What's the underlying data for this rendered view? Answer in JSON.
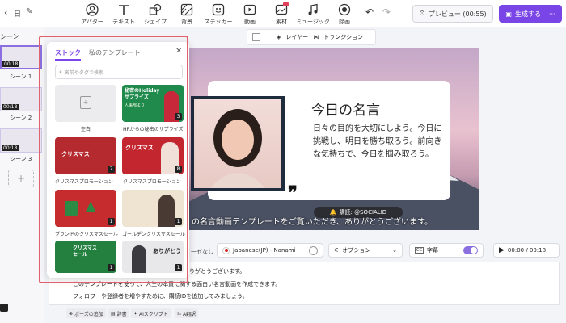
{
  "topbar": {
    "tools": [
      {
        "label": "アバター",
        "icon": "avatar-icon"
      },
      {
        "label": "テキスト",
        "icon": "text-icon"
      },
      {
        "label": "シェイプ",
        "icon": "shape-icon"
      },
      {
        "label": "背景",
        "icon": "background-icon"
      },
      {
        "label": "ステッカー",
        "icon": "sticker-icon"
      },
      {
        "label": "動画",
        "icon": "video-icon"
      },
      {
        "label": "素材",
        "icon": "material-icon"
      },
      {
        "label": "ミュージック",
        "icon": "music-icon"
      },
      {
        "label": "録画",
        "icon": "record-icon"
      }
    ],
    "left_label": "日",
    "preview": "プレビュー (00:55)",
    "generate": "生成する",
    "more": "···"
  },
  "scenes": {
    "header": "シーン",
    "items": [
      {
        "label": "シーン 1",
        "time": "00:18"
      },
      {
        "label": "シーン 2",
        "time": "00:18"
      },
      {
        "label": "シーン 3",
        "time": "00:18"
      }
    ]
  },
  "canvas_bar": {
    "layer": "レイヤー",
    "transition": "トランジション"
  },
  "stage": {
    "title": "今日の名言",
    "body": "日々の目的を大切にしよう。今日に挑戦し、明日を勝ち取ろう。前向きな気持ちで、今日を掴み取ろう。",
    "subscribe": "購読: @SOCIALID",
    "subtitle": "の名言動画テンプレートをご覧いただき、ありがとうございます。"
  },
  "controls": {
    "pause": "一ゼなし",
    "voice": "Japanese(JP) - Nanami",
    "option": "オプション",
    "caption": "字幕",
    "time": "00:00 / 00:18"
  },
  "script": {
    "lines": [
      "りがとうございます。",
      "このテンプレートを使って、人生の本質に関する面白い名言動画を作成できます。",
      "フォロワーや登録者を増やすために、購読IDを追加してみましょう。"
    ],
    "chips": [
      "ポーズの追加",
      "辞書",
      "AIスクリプト",
      "A翻訳"
    ]
  },
  "panel": {
    "tab_stock": "ストック",
    "tab_mine": "私のテンプレート",
    "search_placeholder": "名前やタグで検索",
    "templates": [
      {
        "label": "空白",
        "count": ""
      },
      {
        "label": "HRからの秘密のサプライズ",
        "count": "3",
        "thumb_title": "秘密のHoliday サプライズ",
        "thumb_sub": "人事部より"
      },
      {
        "label": "クリスマスプロモーション",
        "count": "7",
        "thumb_title": "クリスマス"
      },
      {
        "label": "クリスマスプロモーション",
        "count": "8",
        "thumb_title": "クリスマス"
      },
      {
        "label": "ブランドのクリスマスセール",
        "count": "1",
        "thumb_title": ""
      },
      {
        "label": "ゴールデンクリスマスセール",
        "count": "1",
        "thumb_title": ""
      },
      {
        "label": "",
        "count": "1",
        "thumb_title": "クリスマス セール"
      },
      {
        "label": "",
        "count": "1",
        "thumb_title": "ありがとう"
      }
    ]
  },
  "colors": {
    "accent": "#7a45e6",
    "highlight": "#e0606e",
    "stock_tab": "#7a45e6"
  }
}
